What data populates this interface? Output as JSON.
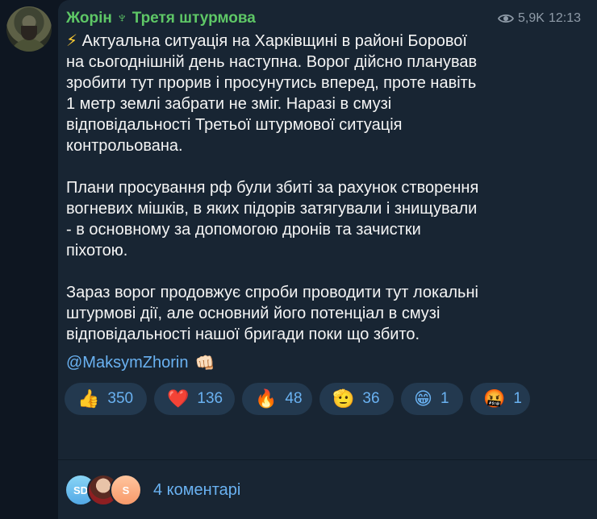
{
  "channel": {
    "name": "Жорін ♆ Третя штурмова"
  },
  "meta": {
    "views": "5,9K",
    "time": "12:13"
  },
  "message": {
    "lightning": "⚡",
    "paragraph1": "Актуальна ситуація на Харківщині в районі Борової\nна сьогоднішній день наступна. Ворог дійсно планував\nзробити тут прорив і просунутись вперед, проте навіть\n1 метр землі забрати не зміг. Наразі в смузі\nвідповідальності Третьої штурмової ситуація\nконтрольована.",
    "paragraph2": "Плани просування рф були збиті за рахунок створення\nвогневих мішків, в яких підорів затягували і знищували\n- в основному за допомогою дронів та зачистки\nпіхотою.",
    "paragraph3": "Зараз ворог продовжує спроби проводити тут локальні\nштурмові дії, але основний його потенціал в смузі\nвідповідальності нашої бригади поки що збито.",
    "mention": "@MaksymZhorin",
    "mention_emoji": "👊🏻"
  },
  "reactions": [
    {
      "emoji": "👍",
      "count": "350"
    },
    {
      "emoji": "❤️",
      "count": "136"
    },
    {
      "emoji": "🔥",
      "count": "48"
    },
    {
      "emoji": "🫡",
      "count": "36"
    },
    {
      "emoji": "😁",
      "count": "1"
    },
    {
      "emoji": "🤬",
      "count": "1"
    }
  ],
  "comments": {
    "avatars": [
      "SD",
      "",
      "S"
    ],
    "label": "4 коментарі"
  },
  "colors": {
    "background": "#0e1621",
    "bubble": "#182533",
    "channel_name": "#5ec766",
    "link": "#6ab2f2",
    "reaction_bg": "#23394f"
  }
}
